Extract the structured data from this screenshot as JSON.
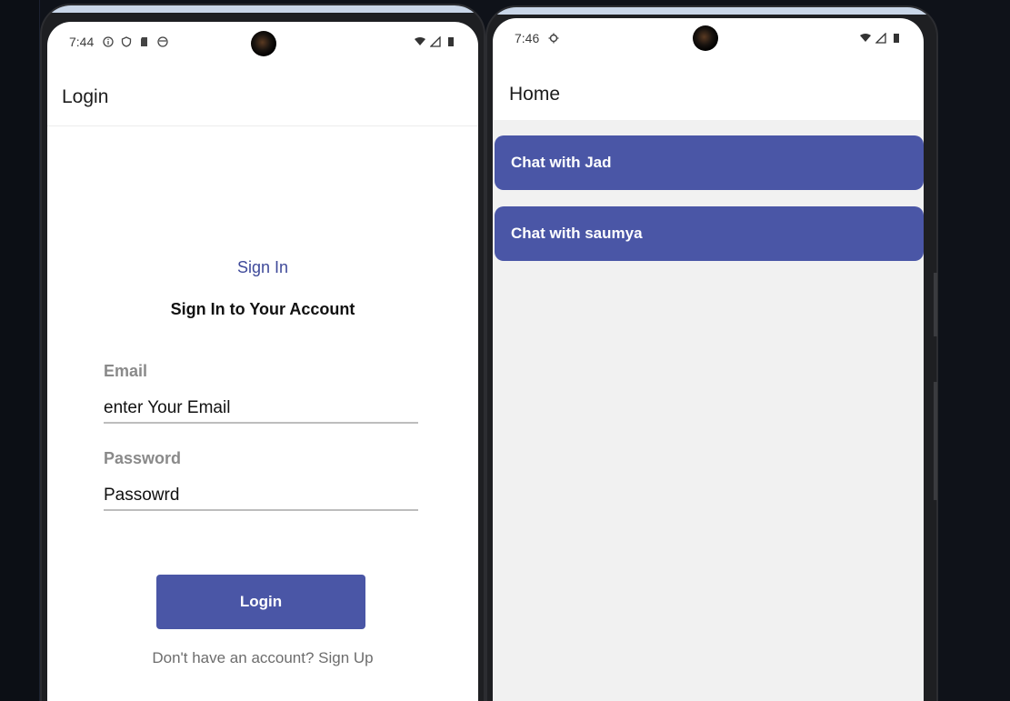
{
  "login_screen": {
    "status_time": "7:44",
    "app_bar_title": "Login",
    "sign_in_title": "Sign In",
    "sign_in_subtitle": "Sign In to Your Account",
    "email_label": "Email",
    "email_value": "enter Your Email",
    "password_label": "Password",
    "password_value": "Passowrd",
    "login_button": "Login",
    "signup_prompt": "Don't have an account? Sign Up"
  },
  "home_screen": {
    "status_time": "7:46",
    "app_bar_title": "Home",
    "chats": [
      {
        "label": "Chat with Jad"
      },
      {
        "label": "Chat with saumya"
      }
    ]
  },
  "colors": {
    "primary": "#4a56a6",
    "link": "#3f4a9a",
    "home_background": "#f1f1f1"
  }
}
